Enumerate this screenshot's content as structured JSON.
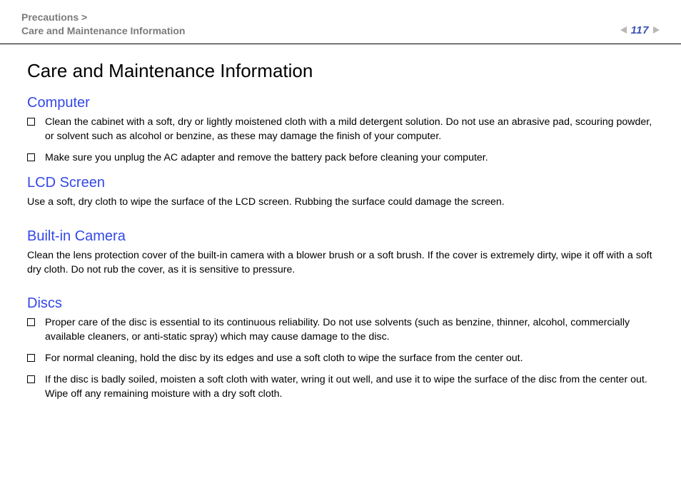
{
  "header": {
    "breadcrumb_parent": "Precautions",
    "breadcrumb_sep": ">",
    "breadcrumb_current": "Care and Maintenance Information",
    "page_number": "117"
  },
  "title": "Care and Maintenance Information",
  "sections": {
    "computer": {
      "heading": "Computer",
      "items": [
        "Clean the cabinet with a soft, dry or lightly moistened cloth with a mild detergent solution. Do not use an abrasive pad, scouring powder, or solvent such as alcohol or benzine, as these may damage the finish of your computer.",
        "Make sure you unplug the AC adapter and remove the battery pack before cleaning your computer."
      ]
    },
    "lcd": {
      "heading": "LCD Screen",
      "text": "Use a soft, dry cloth to wipe the surface of the LCD screen. Rubbing the surface could damage the screen."
    },
    "camera": {
      "heading": "Built-in Camera",
      "text": "Clean the lens protection cover of the built-in camera with a blower brush or a soft brush. If the cover is extremely dirty, wipe it off with a soft dry cloth. Do not rub the cover, as it is sensitive to pressure."
    },
    "discs": {
      "heading": "Discs",
      "items": [
        "Proper care of the disc is essential to its continuous reliability. Do not use solvents (such as benzine, thinner, alcohol, commercially available cleaners, or anti-static spray) which may cause damage to the disc.",
        "For normal cleaning, hold the disc by its edges and use a soft cloth to wipe the surface from the center out.",
        "If the disc is badly soiled, moisten a soft cloth with water, wring it out well, and use it to wipe the surface of the disc from the center out. Wipe off any remaining moisture with a dry soft cloth."
      ]
    }
  }
}
